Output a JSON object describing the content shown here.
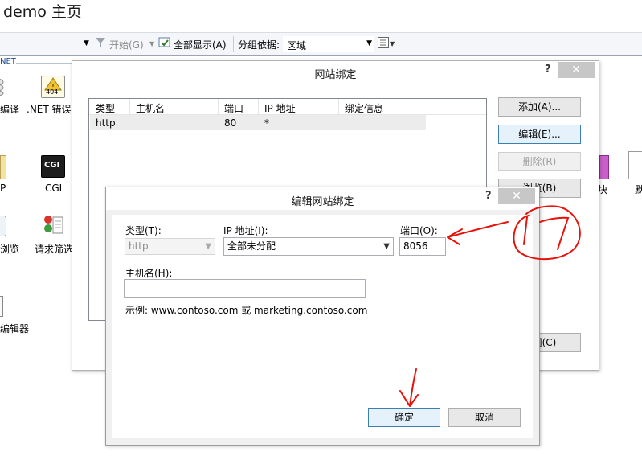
{
  "page": {
    "title": "demo 主页"
  },
  "toolbar": {
    "open_label": "开始(G)",
    "show_all_label": "全部显示(A)",
    "group_by_label": "分组依据:",
    "group_by_value": "区域"
  },
  "background": {
    "section_label": "NET",
    "features": [
      {
        "label": "编译"
      },
      {
        "label": ".NET 错误"
      },
      {
        "label": "P"
      },
      {
        "label": "CGI"
      },
      {
        "label": "浏览"
      },
      {
        "label": "请求筛选"
      },
      {
        "label": "编辑器"
      },
      {
        "label": "块"
      },
      {
        "label": "默"
      }
    ],
    "icon_404_text": "404",
    "icon_cgi_text": "CGI"
  },
  "site_bindings": {
    "title": "网站绑定",
    "help_glyph": "?",
    "close_glyph": "✕",
    "columns": [
      "类型",
      "主机名",
      "端口",
      "IP 地址",
      "绑定信息"
    ],
    "rows": [
      {
        "type": "http",
        "host": "",
        "port": "80",
        "ip": "*",
        "info": ""
      }
    ],
    "buttons": {
      "add": "添加(A)...",
      "edit": "编辑(E)...",
      "remove": "删除(R)",
      "browse": "浏览(B)",
      "close": "关闭(C)"
    }
  },
  "edit_binding": {
    "title": "编辑网站绑定",
    "help_glyph": "?",
    "close_glyph": "✕",
    "type_label": "类型(T):",
    "type_value": "http",
    "ip_label": "IP 地址(I):",
    "ip_value": "全部未分配",
    "port_label": "端口(O):",
    "port_value": "8056",
    "host_label": "主机名(H):",
    "host_value": "",
    "example_text": "示例: www.contoso.com 或 marketing.contoso.com",
    "ok_label": "确定",
    "cancel_label": "取消"
  },
  "colors": {
    "annotation": "#e8120c",
    "accent": "#3c7fb1"
  },
  "icons": [
    "filter-icon",
    "show-all-icon",
    "view-icon",
    "error-404-icon",
    "cgi-icon",
    "request-filter-icon"
  ]
}
